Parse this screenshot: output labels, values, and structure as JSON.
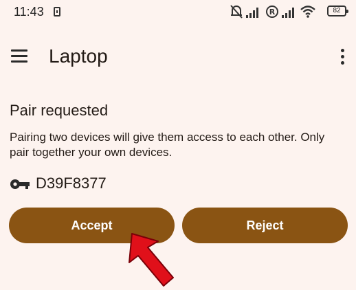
{
  "status_bar": {
    "time": "11:43",
    "battery": "82"
  },
  "app_bar": {
    "title": "Laptop",
    "menu_icon": "hamburger-menu-icon",
    "overflow_icon": "more-vert-icon"
  },
  "pair": {
    "heading": "Pair requested",
    "description": "Pairing two devices will give them access to each other. Only pair together your own devices.",
    "key_icon": "key-icon",
    "key_code": "D39F8377"
  },
  "actions": {
    "accept_label": "Accept",
    "reject_label": "Reject"
  },
  "colors": {
    "background": "#fdf3ef",
    "button": "#8a5413",
    "annotation_arrow": "#e0101a"
  }
}
